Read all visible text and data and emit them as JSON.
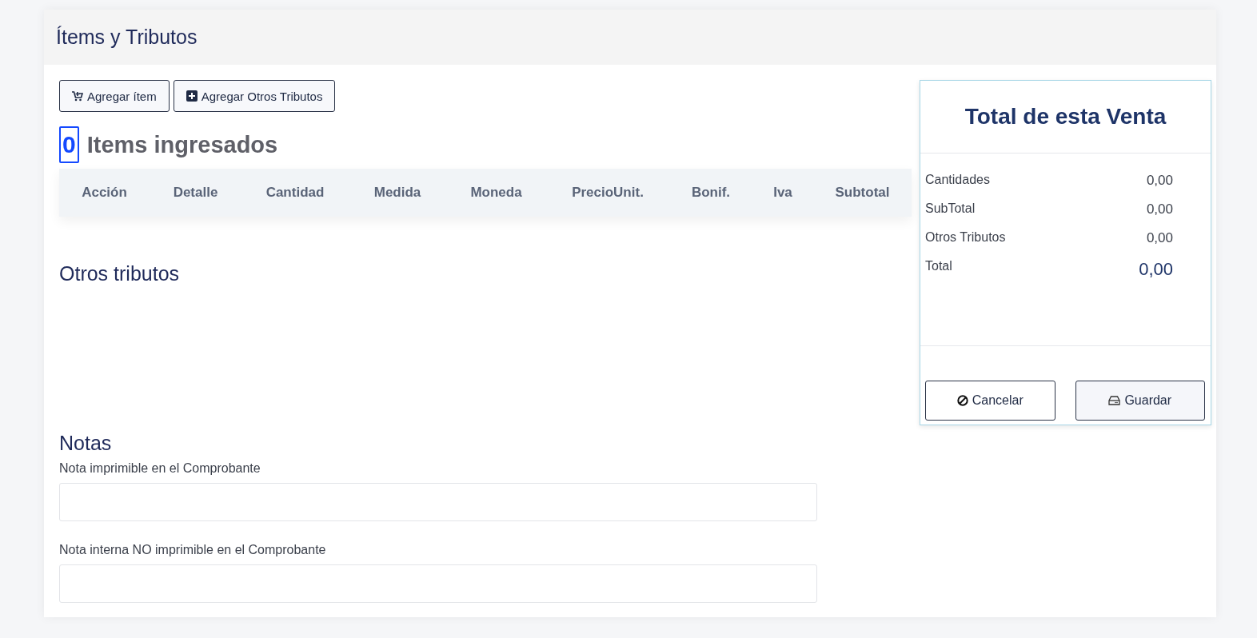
{
  "section_title": "Ítems y Tributos",
  "buttons": [
    {
      "kind": "cart",
      "label": "Agregar ítem"
    },
    {
      "kind": "plus",
      "label": "Agregar Otros Tributos"
    }
  ],
  "items_count": "0",
  "items_heading": "Items ingresados",
  "table": {
    "columns": [
      "Acción",
      "Detalle",
      "Cantidad",
      "Medida",
      "Moneda",
      "PrecioUnit.",
      "Bonif.",
      "Iva",
      "Subtotal"
    ]
  },
  "other_taxes_heading": "Otros tributos",
  "notes": {
    "heading": "Notas",
    "fields": [
      {
        "label": "Nota imprimible en el Comprobante"
      },
      {
        "label": "Nota interna NO imprimible en el Comprobante"
      }
    ]
  },
  "summary": {
    "title": "Total de esta Venta",
    "rows": [
      {
        "kind": "normal",
        "label": "Cantidades",
        "value": "0,00"
      },
      {
        "kind": "normal",
        "label": "SubTotal",
        "value": "0,00"
      },
      {
        "kind": "normal",
        "label": "Otros Tributos",
        "value": "0,00"
      },
      {
        "kind": "total",
        "label": "Total",
        "value": "0,00"
      }
    ],
    "actions": [
      {
        "kind": "cancel",
        "label": "Cancelar"
      },
      {
        "kind": "save",
        "label": "Guardar"
      }
    ]
  }
}
